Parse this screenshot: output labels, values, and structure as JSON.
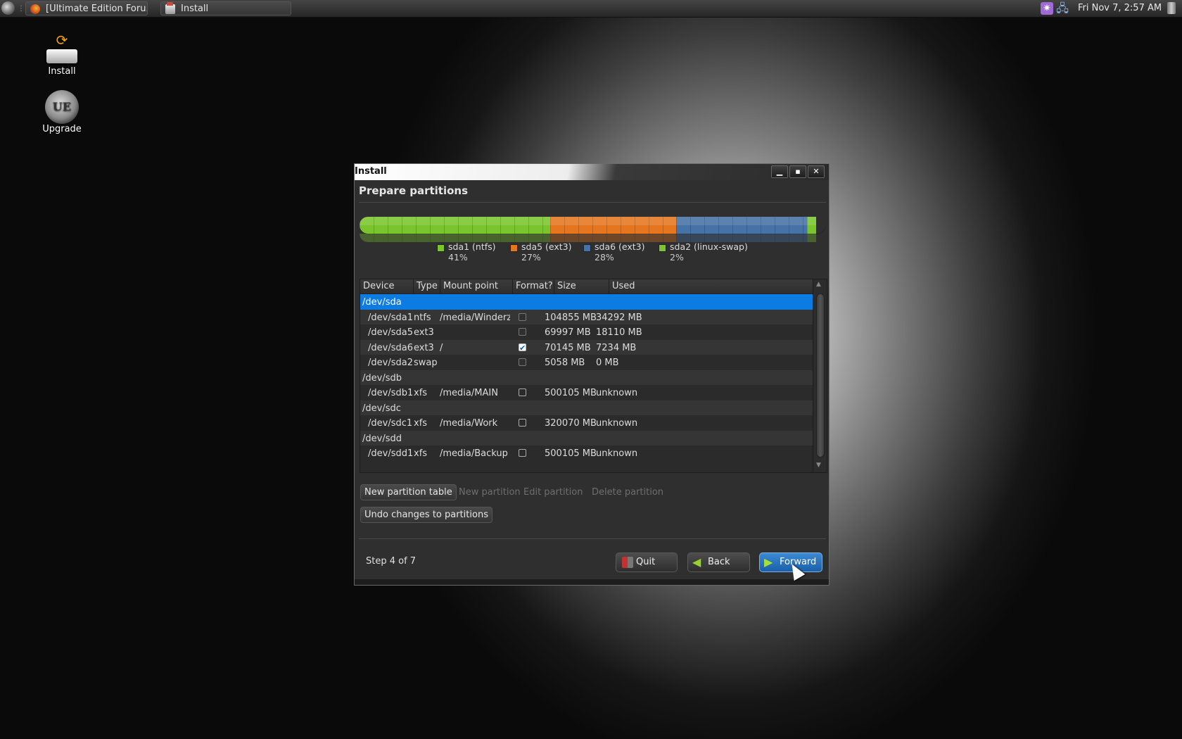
{
  "taskbar": {
    "tasks": [
      {
        "label": "[Ultimate Edition Foru...",
        "icon": "firefox-icon"
      },
      {
        "label": "Install",
        "icon": "disk-install-icon"
      }
    ],
    "clock": "Fri Nov  7,  2:57 AM",
    "tray_icons": [
      "settings-icon",
      "network-icon",
      "trash-icon"
    ]
  },
  "desktop": {
    "icons": [
      {
        "label": "Install",
        "icon": "installer-drive-icon"
      },
      {
        "label": "Upgrade",
        "icon": "ue-upgrade-icon"
      }
    ]
  },
  "window": {
    "title": "Install",
    "heading": "Prepare partitions",
    "partition_bar": {
      "segments": [
        {
          "name": "sda1 (ntfs)",
          "percent_label": "41%",
          "fraction": 0.41,
          "color": "#7ac52d"
        },
        {
          "name": "sda5 (ext3)",
          "percent_label": "27%",
          "fraction": 0.27,
          "color": "#e5761e"
        },
        {
          "name": "sda6 (ext3)",
          "percent_label": "28%",
          "fraction": 0.28,
          "color": "#4672a6"
        },
        {
          "name": "sda2 (linux-swap)",
          "percent_label": "2%",
          "fraction": 0.02,
          "color": "#7ac52d"
        }
      ]
    },
    "table": {
      "columns": [
        "Device",
        "Type",
        "Mount point",
        "Format?",
        "Size",
        "Used"
      ],
      "rows": [
        {
          "device": "/dev/sda",
          "type": "",
          "mount": "",
          "format": null,
          "size": "",
          "used": "",
          "selected": true,
          "is_disk": true
        },
        {
          "device": "/dev/sda1",
          "type": "ntfs",
          "mount": "/media/Winderz",
          "format": false,
          "size": "104855 MB",
          "used": "34292 MB"
        },
        {
          "device": "/dev/sda5",
          "type": "ext3",
          "mount": "",
          "format": false,
          "size": "69997 MB",
          "used": "18110 MB"
        },
        {
          "device": "/dev/sda6",
          "type": "ext3",
          "mount": "/",
          "format": true,
          "size": "70145 MB",
          "used": "7234 MB"
        },
        {
          "device": "/dev/sda2",
          "type": "swap",
          "mount": "",
          "format": false,
          "size": "5058 MB",
          "used": "0 MB"
        },
        {
          "device": "/dev/sdb",
          "type": "",
          "mount": "",
          "format": null,
          "size": "",
          "used": "",
          "is_disk": true
        },
        {
          "device": "/dev/sdb1",
          "type": "xfs",
          "mount": "/media/MAIN",
          "format": false,
          "size": "500105 MB",
          "used": "unknown"
        },
        {
          "device": "/dev/sdc",
          "type": "",
          "mount": "",
          "format": null,
          "size": "",
          "used": "",
          "is_disk": true
        },
        {
          "device": "/dev/sdc1",
          "type": "xfs",
          "mount": "/media/Work",
          "format": false,
          "size": "320070 MB",
          "used": "unknown"
        },
        {
          "device": "/dev/sdd",
          "type": "",
          "mount": "",
          "format": null,
          "size": "",
          "used": "",
          "is_disk": true
        },
        {
          "device": "/dev/sdd1",
          "type": "xfs",
          "mount": "/media/Backup",
          "format": false,
          "size": "500105 MB",
          "used": "unknown"
        }
      ]
    },
    "buttons": {
      "new_partition_table": "New partition table",
      "new_partition": "New partition",
      "edit_partition": "Edit partition",
      "delete_partition": "Delete partition",
      "undo_changes": "Undo changes to partitions"
    },
    "step": "Step 4 of 7",
    "nav": {
      "quit": "Quit",
      "back": "Back",
      "forward": "Forward"
    }
  }
}
